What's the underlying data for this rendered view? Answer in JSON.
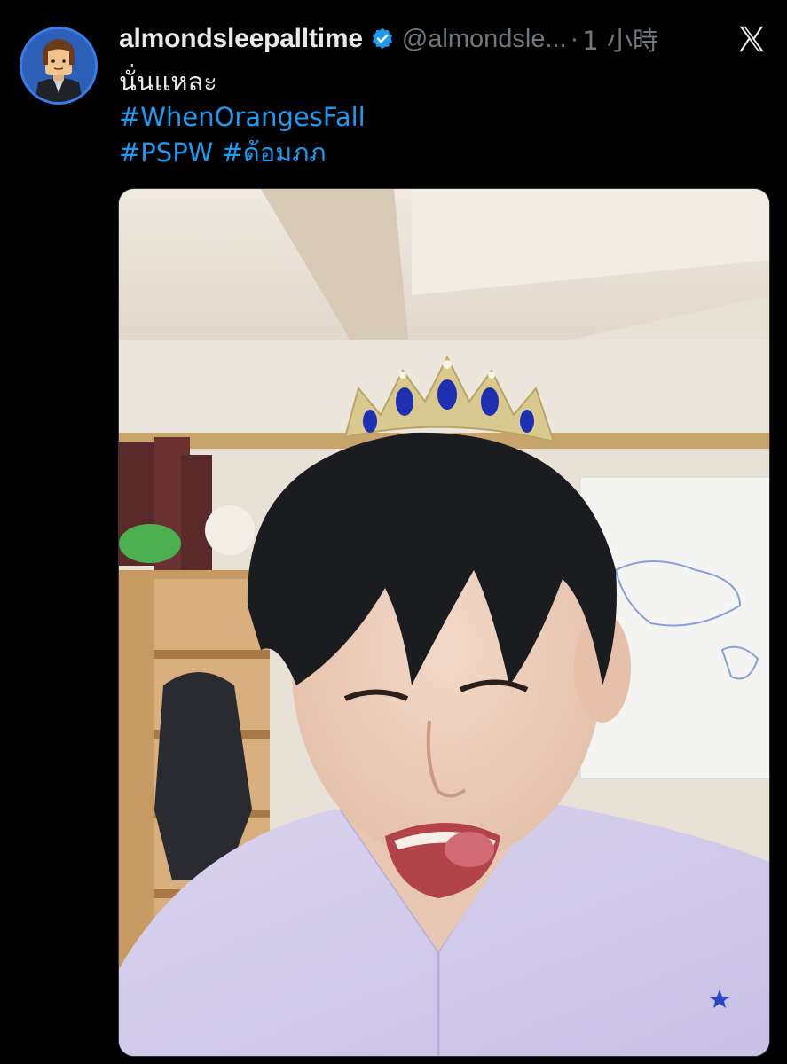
{
  "post": {
    "author": {
      "display_name": "almondsleepalltime",
      "handle": "@almondsle...",
      "verified": true,
      "avatar_icon": "lego-minifigure-avatar"
    },
    "separator": "·",
    "timestamp": "1 小時",
    "platform_icon": "x-logo-icon",
    "text_line": "นั่นแหละ",
    "hashtags_line1": [
      "#WhenOrangesFall"
    ],
    "hashtags_line2": [
      "#PSPW",
      "#ด้อมภภ"
    ],
    "media": {
      "type": "photo",
      "description_icon": "selfie-photo"
    }
  },
  "colors": {
    "background": "#000000",
    "text": "#e7e9ea",
    "muted": "#71767b",
    "link": "#1d9bf0",
    "verified": "#1d9bf0"
  }
}
